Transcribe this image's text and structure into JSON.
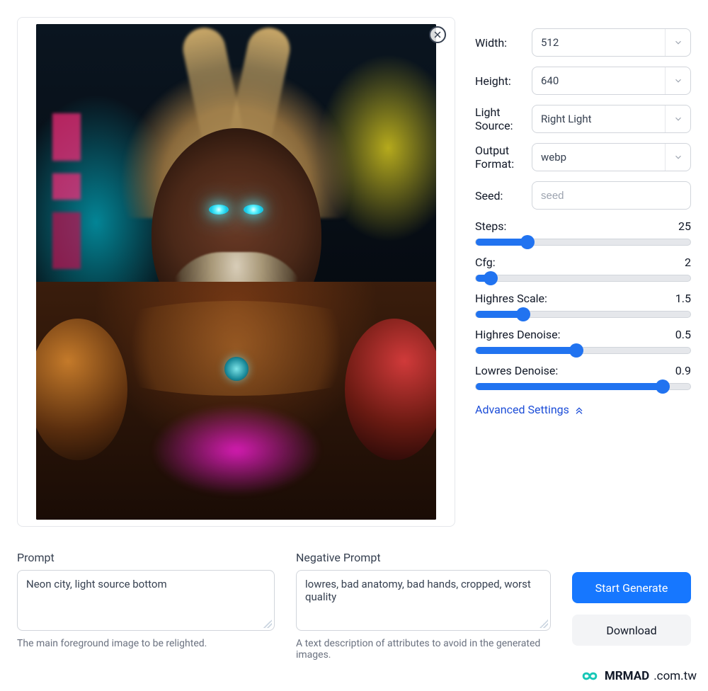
{
  "controls": {
    "width": {
      "label": "Width:",
      "value": "512"
    },
    "height": {
      "label": "Height:",
      "value": "640"
    },
    "lightSource": {
      "label": "Light Source:",
      "value": "Right Light"
    },
    "outputFormat": {
      "label": "Output Format:",
      "value": "webp"
    },
    "seed": {
      "label": "Seed:",
      "placeholder": "seed",
      "value": ""
    }
  },
  "sliders": {
    "steps": {
      "label": "Steps:",
      "value": "25",
      "pct": 24
    },
    "cfg": {
      "label": "Cfg:",
      "value": "2",
      "pct": 7
    },
    "highresScale": {
      "label": "Highres Scale:",
      "value": "1.5",
      "pct": 22
    },
    "highresDenoise": {
      "label": "Highres Denoise:",
      "value": "0.5",
      "pct": 47
    },
    "lowresDenoise": {
      "label": "Lowres Denoise:",
      "value": "0.9",
      "pct": 87
    }
  },
  "advanced": {
    "label": "Advanced Settings"
  },
  "prompt": {
    "label": "Prompt",
    "value": "Neon city, light source bottom",
    "help": "The main foreground image to be relighted."
  },
  "negativePrompt": {
    "label": "Negative Prompt",
    "value": "lowres, bad anatomy, bad hands, cropped, worst quality",
    "help": "A text description of attributes to avoid in the generated images."
  },
  "actions": {
    "generate": "Start Generate",
    "download": "Download"
  },
  "watermark": {
    "bold": "MRMAD",
    "rest": ".com.tw"
  }
}
